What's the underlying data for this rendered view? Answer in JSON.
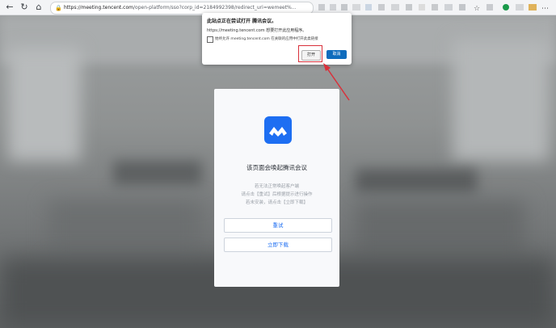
{
  "browser": {
    "url_host": "https://meeting.tencent.com",
    "url_rest": "/open-platform/sso?corp_id=2184992398/redirect_uri=wemeet%...",
    "nav_back_glyph": "←",
    "nav_refresh_glyph": "↻",
    "nav_home_glyph": "⌂",
    "lock_glyph": "🔒"
  },
  "dialog": {
    "title": "此站点正在尝试打开 腾讯会议。",
    "message": "https://meeting.tencent.com 想要打开此应用程序。",
    "checkbox_label": "始终允许 meeting.tencent.com 在关联的应用中打开此类链接",
    "open_label": "打开",
    "cancel_label": "取消"
  },
  "card": {
    "title": "该页面会唤起腾讯会议",
    "tip_line1": "若无法正常唤起客户端",
    "tip_line2": "请点击【重试】后根据提示进行操作",
    "tip_line3": "若未安装，请点击【立即下载】",
    "retry_label": "重试",
    "download_label": "立即下载"
  },
  "colors": {
    "accent": "#1d6ef2",
    "highlight": "#d9303a",
    "dialog_primary": "#0f6cbd"
  }
}
